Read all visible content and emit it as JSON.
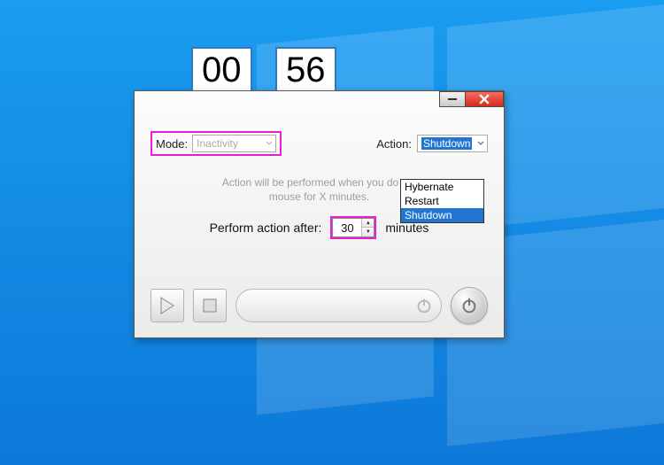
{
  "timer": {
    "minutes": "00",
    "seconds": "56"
  },
  "form": {
    "mode_label": "Mode:",
    "mode_value": "Inactivity",
    "action_label": "Action:",
    "action_value": "Shutdown",
    "action_options": [
      "Hybernate",
      "Restart",
      "Shutdown"
    ],
    "description_line1": "Action will be performed when you do not",
    "description_line2": "mouse for X minutes.",
    "perform_label": "Perform action after:",
    "perform_value": "30",
    "perform_unit": "minutes"
  },
  "colors": {
    "highlight": "#ea1fd4",
    "selection": "#2176d2"
  }
}
